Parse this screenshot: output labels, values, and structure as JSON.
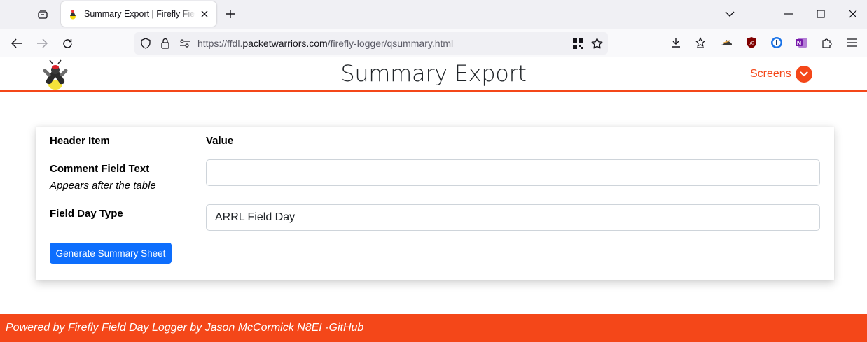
{
  "browser": {
    "tab_title": "Summary Export | Firefly Field Day Logger",
    "url_prefix": "https://ffdl.",
    "url_domain": "packetwarriors.com",
    "url_path": "/firefly-logger/qsummary.html"
  },
  "header": {
    "title": "Summary Export",
    "menu_label": "Screens"
  },
  "form": {
    "col_item": "Header Item",
    "col_value": "Value",
    "comment_label": "Comment Field Text",
    "comment_hint": "Appears after the table",
    "comment_value": "",
    "type_label": "Field Day Type",
    "type_value": "ARRL Field Day",
    "generate_label": "Generate Summary Sheet"
  },
  "footer": {
    "text": "Powered by Firefly Field Day Logger by Jason McCormick N8EI - ",
    "link": "GitHub"
  },
  "colors": {
    "accent": "#f44719",
    "primary_button": "#0d6efd"
  }
}
